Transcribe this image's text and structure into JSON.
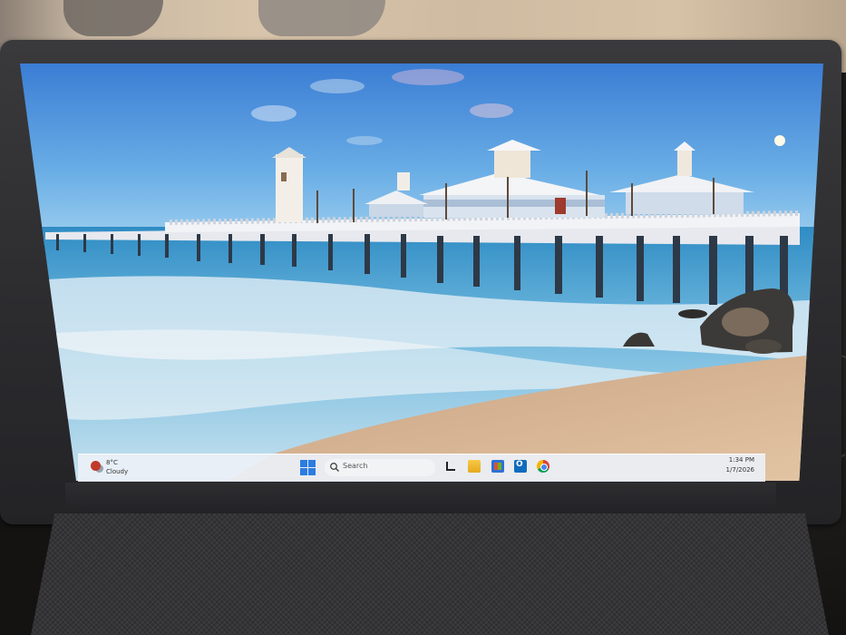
{
  "taskbar": {
    "weather": {
      "temp": "8°C",
      "condition": "Cloudy",
      "icon": "weather-alert-icon"
    },
    "start_icon": "windows-start-icon",
    "search_label": "Search",
    "apps": [
      {
        "name": "task-view",
        "icon": "task-view-icon"
      },
      {
        "name": "file-explorer",
        "icon": "folder-icon"
      },
      {
        "name": "microsoft-store",
        "icon": "store-icon"
      },
      {
        "name": "outlook",
        "icon": "outlook-icon"
      },
      {
        "name": "chrome",
        "icon": "chrome-icon"
      }
    ],
    "clock": {
      "time": "1:34 PM",
      "date": "1/7/2026"
    }
  },
  "colors": {
    "sky_top": "#3a7fd6",
    "sky_bottom": "#8fc3ea",
    "sea": "#3d97c9",
    "sand": "#cfae8c",
    "start_blue": "#2a7de1",
    "bezel": "#2b2b2e"
  }
}
